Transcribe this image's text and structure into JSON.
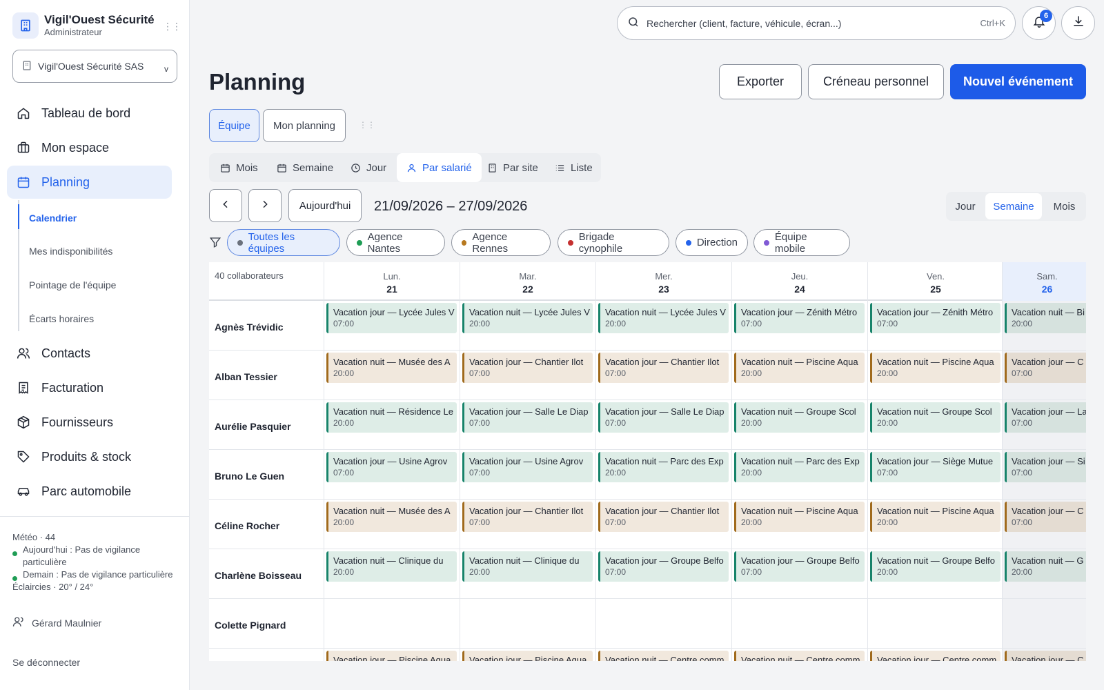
{
  "brand": {
    "name": "Vigil'Ouest Sécurité",
    "role": "Administrateur"
  },
  "org_select": {
    "label": "Vigil'Ouest Sécurité SAS",
    "chevron": "v"
  },
  "nav": {
    "items": [
      {
        "label": "Tableau de bord",
        "icon": "home-icon"
      },
      {
        "label": "Mon espace",
        "icon": "briefcase-icon"
      },
      {
        "label": "Planning",
        "icon": "calendar-icon"
      },
      {
        "label": "Contacts",
        "icon": "users-icon"
      },
      {
        "label": "Facturation",
        "icon": "invoice-icon"
      },
      {
        "label": "Fournisseurs",
        "icon": "package-icon"
      },
      {
        "label": "Produits & stock",
        "icon": "tag-icon"
      },
      {
        "label": "Parc automobile",
        "icon": "car-icon"
      }
    ],
    "sub_items": [
      "Calendrier",
      "Mes indisponibilités",
      "Pointage de l'équipe",
      "Écarts horaires"
    ]
  },
  "weather": {
    "title": "Météo · 44",
    "today": "Aujourd'hui : Pas de vigilance particulière",
    "tomorrow": "Demain : Pas de vigilance particulière",
    "summary": "Éclaircies · 20° / 24°"
  },
  "user": {
    "name": "Gérard Maulnier"
  },
  "logout": "Se déconnecter",
  "search": {
    "placeholder": "Rechercher (client, facture, véhicule, écran...)",
    "shortcut": "Ctrl+K"
  },
  "notifications": {
    "count": "6"
  },
  "page": {
    "title": "Planning"
  },
  "actions": {
    "export": "Exporter",
    "personal_slot": "Créneau personnel",
    "new_event": "Nouvel événement"
  },
  "scope_tabs": {
    "team": "Équipe",
    "mine": "Mon planning"
  },
  "view_tabs": [
    "Mois",
    "Semaine",
    "Jour",
    "Par salarié",
    "Par site",
    "Liste"
  ],
  "toolbar": {
    "today": "Aujourd'hui",
    "range": "21/09/2026 – 27/09/2026",
    "day": "Jour",
    "week": "Semaine",
    "month": "Mois"
  },
  "filters": [
    {
      "label": "Toutes les équipes",
      "color": "#6b717c"
    },
    {
      "label": "Agence Nantes",
      "color": "#1f9d55"
    },
    {
      "label": "Agence Rennes",
      "color": "#b7791f"
    },
    {
      "label": "Brigade cynophile",
      "color": "#c53030"
    },
    {
      "label": "Direction",
      "color": "#2463eb"
    },
    {
      "label": "Équipe mobile",
      "color": "#805ad5"
    }
  ],
  "schedule": {
    "count_label": "40 collaborateurs",
    "days": [
      {
        "name": "Lun.",
        "num": "21"
      },
      {
        "name": "Mar.",
        "num": "22"
      },
      {
        "name": "Mer.",
        "num": "23"
      },
      {
        "name": "Jeu.",
        "num": "24"
      },
      {
        "name": "Ven.",
        "num": "25"
      },
      {
        "name": "Sam.",
        "num": "26"
      }
    ],
    "rows": [
      {
        "name": "Agnès Trévidic",
        "events": [
          {
            "title": "Vacation jour — Lycée Jules V",
            "time": "07:00",
            "color": "green"
          },
          {
            "title": "Vacation nuit — Lycée Jules V",
            "time": "20:00",
            "color": "green"
          },
          {
            "title": "Vacation nuit — Lycée Jules V",
            "time": "20:00",
            "color": "green"
          },
          {
            "title": "Vacation jour — Zénith Métro",
            "time": "07:00",
            "color": "green"
          },
          {
            "title": "Vacation jour — Zénith Métro",
            "time": "07:00",
            "color": "green"
          },
          {
            "title": "Vacation nuit — Bi",
            "time": "20:00",
            "color": "green"
          }
        ]
      },
      {
        "name": "Alban Tessier",
        "events": [
          {
            "title": "Vacation nuit — Musée des A",
            "time": "20:00",
            "color": "brown"
          },
          {
            "title": "Vacation jour — Chantier Ilot",
            "time": "07:00",
            "color": "brown"
          },
          {
            "title": "Vacation jour — Chantier Ilot",
            "time": "07:00",
            "color": "brown"
          },
          {
            "title": "Vacation nuit — Piscine Aqua",
            "time": "20:00",
            "color": "brown"
          },
          {
            "title": "Vacation nuit — Piscine Aqua",
            "time": "20:00",
            "color": "brown"
          },
          {
            "title": "Vacation jour — C",
            "time": "07:00",
            "color": "brown"
          }
        ]
      },
      {
        "name": "Aurélie Pasquier",
        "events": [
          {
            "title": "Vacation nuit — Résidence Le",
            "time": "20:00",
            "color": "green"
          },
          {
            "title": "Vacation jour — Salle Le Diap",
            "time": "07:00",
            "color": "green"
          },
          {
            "title": "Vacation jour — Salle Le Diap",
            "time": "07:00",
            "color": "green"
          },
          {
            "title": "Vacation nuit — Groupe Scol",
            "time": "20:00",
            "color": "green"
          },
          {
            "title": "Vacation nuit — Groupe Scol",
            "time": "20:00",
            "color": "green"
          },
          {
            "title": "Vacation jour — La",
            "time": "07:00",
            "color": "green"
          }
        ]
      },
      {
        "name": "Bruno Le Guen",
        "events": [
          {
            "title": "Vacation jour — Usine Agrov",
            "time": "07:00",
            "color": "green"
          },
          {
            "title": "Vacation jour — Usine Agrov",
            "time": "07:00",
            "color": "green"
          },
          {
            "title": "Vacation nuit — Parc des Exp",
            "time": "20:00",
            "color": "green"
          },
          {
            "title": "Vacation nuit — Parc des Exp",
            "time": "20:00",
            "color": "green"
          },
          {
            "title": "Vacation jour — Siège Mutue",
            "time": "07:00",
            "color": "green"
          },
          {
            "title": "Vacation jour — Si",
            "time": "07:00",
            "color": "green"
          }
        ]
      },
      {
        "name": "Céline Rocher",
        "events": [
          {
            "title": "Vacation nuit — Musée des A",
            "time": "20:00",
            "color": "brown"
          },
          {
            "title": "Vacation jour — Chantier Ilot",
            "time": "07:00",
            "color": "brown"
          },
          {
            "title": "Vacation jour — Chantier Ilot",
            "time": "07:00",
            "color": "brown"
          },
          {
            "title": "Vacation nuit — Piscine Aqua",
            "time": "20:00",
            "color": "brown"
          },
          {
            "title": "Vacation nuit — Piscine Aqua",
            "time": "20:00",
            "color": "brown"
          },
          {
            "title": "Vacation jour — C",
            "time": "07:00",
            "color": "brown"
          }
        ]
      },
      {
        "name": "Charlène Boisseau",
        "events": [
          {
            "title": "Vacation nuit — Clinique du",
            "time": "20:00",
            "color": "green"
          },
          {
            "title": "Vacation nuit — Clinique du",
            "time": "20:00",
            "color": "green"
          },
          {
            "title": "Vacation jour — Groupe Belfo",
            "time": "07:00",
            "color": "green"
          },
          {
            "title": "Vacation jour — Groupe Belfo",
            "time": "07:00",
            "color": "green"
          },
          {
            "title": "Vacation nuit — Groupe Belfo",
            "time": "20:00",
            "color": "green"
          },
          {
            "title": "Vacation nuit — G",
            "time": "20:00",
            "color": "green"
          }
        ]
      },
      {
        "name": "Colette Pignard",
        "events": []
      },
      {
        "name": "",
        "events": [
          {
            "title": "Vacation jour — Piscine Aqua",
            "time": "",
            "color": "brown"
          },
          {
            "title": "Vacation jour — Piscine Aqua",
            "time": "",
            "color": "brown"
          },
          {
            "title": "Vacation nuit — Centre comm",
            "time": "",
            "color": "brown"
          },
          {
            "title": "Vacation nuit — Centre comm",
            "time": "",
            "color": "brown"
          },
          {
            "title": "Vacation jour — Centre comm",
            "time": "",
            "color": "brown"
          },
          {
            "title": "Vacation jour — C",
            "time": "",
            "color": "brown"
          }
        ]
      }
    ]
  }
}
